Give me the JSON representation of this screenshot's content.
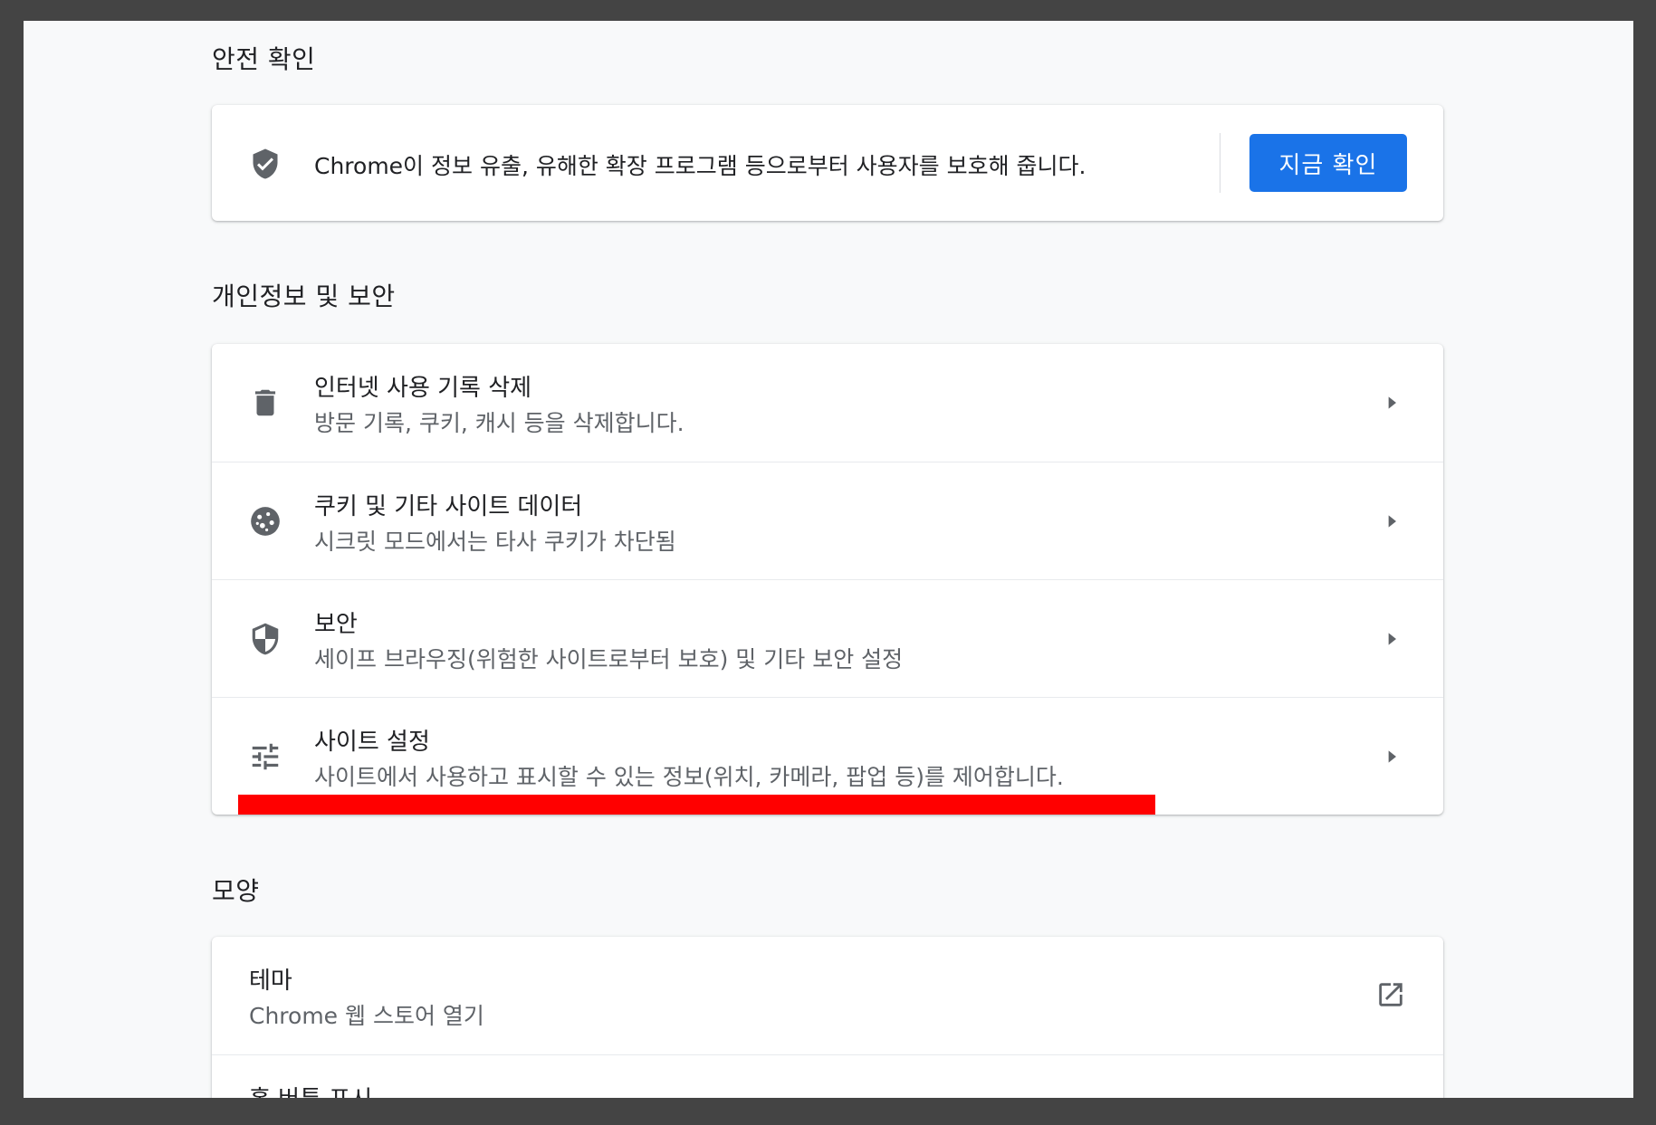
{
  "sections": {
    "safety_check": {
      "title": "안전 확인",
      "description": "Chrome이 정보 유출, 유해한 확장 프로그램 등으로부터 사용자를 보호해 줍니다.",
      "button_label": "지금 확인",
      "icon": "shield-check-icon"
    },
    "privacy": {
      "title": "개인정보 및 보안",
      "items": [
        {
          "label": "인터넷 사용 기록 삭제",
          "sublabel": "방문 기록, 쿠키, 캐시 등을 삭제합니다.",
          "icon": "trash-icon"
        },
        {
          "label": "쿠키 및 기타 사이트 데이터",
          "sublabel": "시크릿 모드에서는 타사 쿠키가 차단됨",
          "icon": "cookie-icon"
        },
        {
          "label": "보안",
          "sublabel": "세이프 브라우징(위험한 사이트로부터 보호) 및 기타 보안 설정",
          "icon": "shield-icon"
        },
        {
          "label": "사이트 설정",
          "sublabel": "사이트에서 사용하고 표시할 수 있는 정보(위치, 카메라, 팝업 등)를 제어합니다.",
          "icon": "tune-icon"
        }
      ]
    },
    "appearance": {
      "title": "모양",
      "items": [
        {
          "label": "테마",
          "sublabel": "Chrome 웹 스토어 열기",
          "icon": "open-in-new-icon"
        },
        {
          "label": "홈 버튼 표시"
        }
      ]
    }
  },
  "colors": {
    "accent": "#1a73e8",
    "highlight": "#ff0000",
    "icon": "#5f6368",
    "background": "#f8f9fa",
    "frame": "#444444"
  }
}
